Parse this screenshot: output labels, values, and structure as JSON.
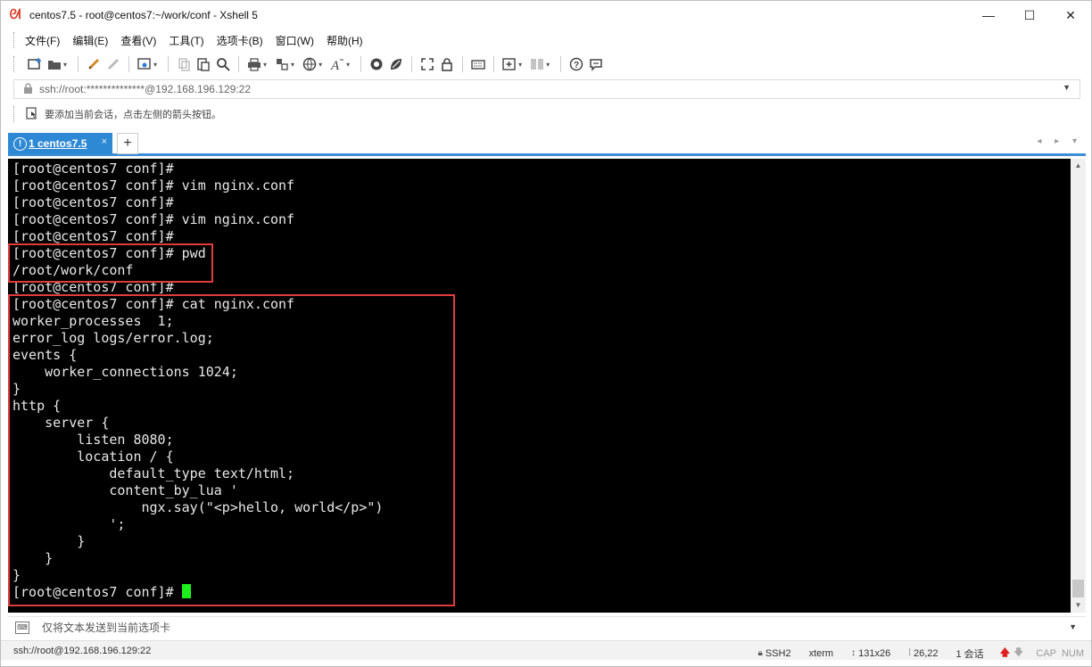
{
  "window": {
    "title": "centos7.5 - root@centos7:~/work/conf - Xshell 5",
    "icon": "xshell-app-icon",
    "controls": {
      "minimize": "—",
      "maximize": "☐",
      "close": "✕"
    }
  },
  "menu": [
    "文件(F)",
    "编辑(E)",
    "查看(V)",
    "工具(T)",
    "选项卡(B)",
    "窗口(W)",
    "帮助(H)"
  ],
  "toolbar": {
    "icons": [
      "new-session-icon",
      "open-folder-icon",
      "reconnect-icon",
      "disconnect-icon",
      "properties-icon",
      "copy-icon",
      "paste-icon",
      "find-icon",
      "print-icon",
      "transfer-icon",
      "globe-icon",
      "font-icon",
      "xftp-icon",
      "xagent-icon",
      "fullscreen-icon",
      "lock-icon",
      "keyboard-icon",
      "new-tab-icon",
      "layout-icon",
      "help-icon",
      "chat-icon"
    ]
  },
  "address": {
    "text": "ssh://root:**************@192.168.196.129:22"
  },
  "hint": {
    "text": "要添加当前会话，点击左侧的箭头按钮。"
  },
  "tabs": [
    {
      "badge": "!",
      "label": "1 centos7.5",
      "close": "×",
      "active": true
    }
  ],
  "tab_add": "+",
  "tab_nav": "◂ ▸ ▾",
  "terminal": {
    "lines": [
      "[root@centos7 conf]#",
      "[root@centos7 conf]# vim nginx.conf",
      "[root@centos7 conf]#",
      "[root@centos7 conf]# vim nginx.conf",
      "[root@centos7 conf]#",
      "[root@centos7 conf]# pwd",
      "/root/work/conf",
      "[root@centos7 conf]#",
      "[root@centos7 conf]# cat nginx.conf",
      "worker_processes  1;",
      "error_log logs/error.log;",
      "events {",
      "    worker_connections 1024;",
      "}",
      "http {",
      "    server {",
      "        listen 8080;",
      "        location / {",
      "            default_type text/html;",
      "            content_by_lua '",
      "                ngx.say(\"<p>hello, world</p>\")",
      "            ';",
      "        }",
      "    }",
      "}",
      "[root@centos7 conf]# "
    ],
    "cursor_color": "#1cf01c",
    "highlight_color": "#e03c3c"
  },
  "compose": {
    "placeholder": "仅将文本发送到当前选项卡"
  },
  "status": {
    "connection": "ssh://root@192.168.196.129:22",
    "protocol": "SSH2",
    "terminal_type": "xterm",
    "size": "131x26",
    "position": "26,22",
    "sessions": "1 会话",
    "caps": "CAP",
    "num": "NUM"
  }
}
